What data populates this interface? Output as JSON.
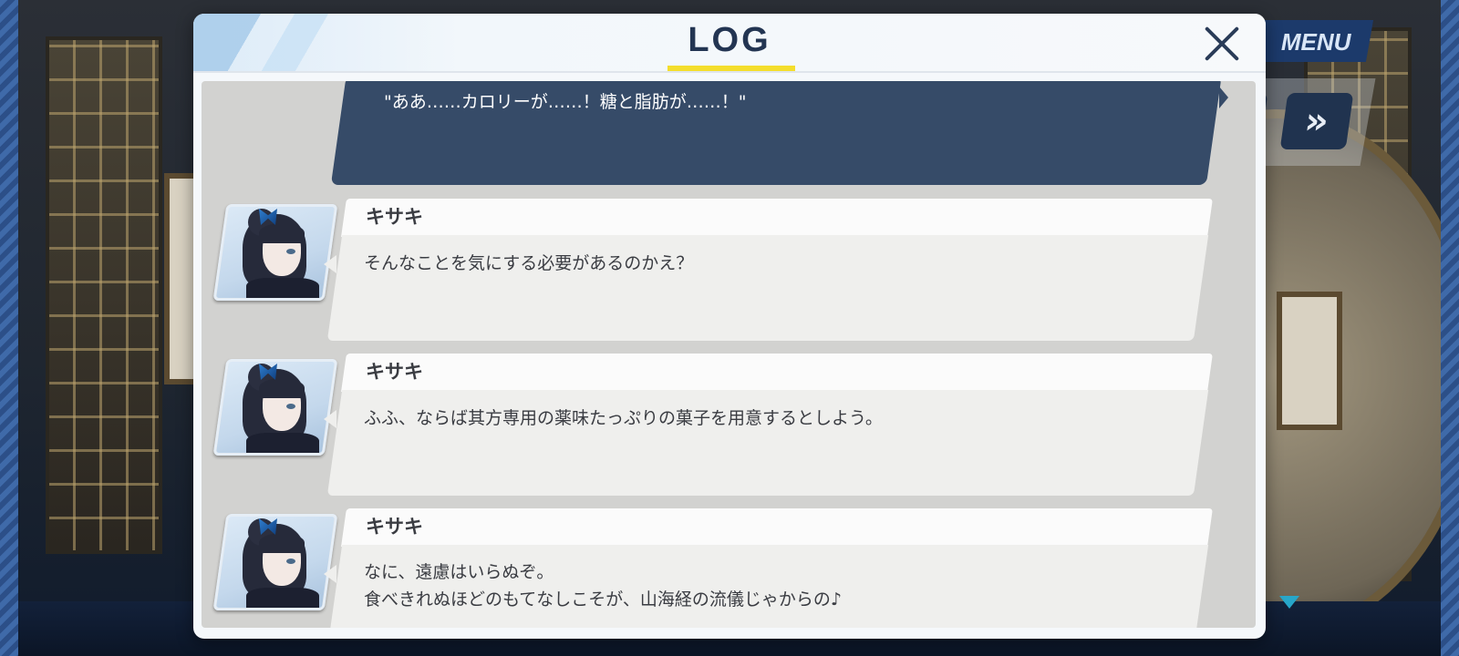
{
  "dialog": {
    "title": "LOG"
  },
  "hud": {
    "menu_label": "MENU",
    "fast_forward_glyph": "»"
  },
  "log": {
    "player_line": "\"ああ……カロリーが……！糖と脂肪が……！\"",
    "entries": [
      {
        "speaker": "キサキ",
        "lines": [
          "そんなことを気にする必要があるのかえ？"
        ]
      },
      {
        "speaker": "キサキ",
        "lines": [
          "ふふ、ならば其方専用の薬味たっぷりの菓子を用意するとしよう。"
        ]
      },
      {
        "speaker": "キサキ",
        "lines": [
          "なに、遠慮はいらぬぞ。",
          "食べきれぬほどのもてなしこそが、山海経の流儀じゃからの♪"
        ]
      }
    ]
  }
}
